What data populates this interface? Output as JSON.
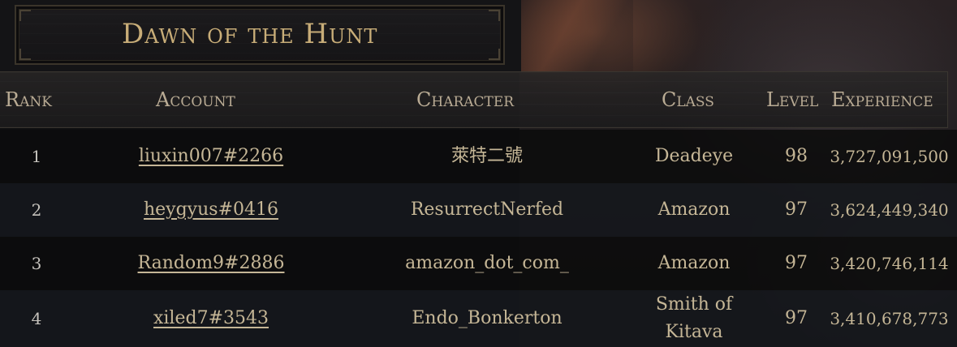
{
  "title": "Dawn of the Hunt",
  "columns": {
    "rank": "Rank",
    "account": "Account",
    "character": "Character",
    "class": "Class",
    "level": "Level",
    "experience": "Experience"
  },
  "rows": [
    {
      "rank": "1",
      "account": "liuxin007#2266",
      "character": "萊特二號",
      "class": "Deadeye",
      "level": "98",
      "experience": "3,727,091,500"
    },
    {
      "rank": "2",
      "account": "heygyus#0416",
      "character": "ResurrectNerfed",
      "class": "Amazon",
      "level": "97",
      "experience": "3,624,449,340"
    },
    {
      "rank": "3",
      "account": "Random9#2886",
      "character": "amazon_dot_com_",
      "class": "Amazon",
      "level": "97",
      "experience": "3,420,746,114"
    },
    {
      "rank": "4",
      "account": "xiled7#3543",
      "character": "Endo_Bonkerton",
      "class": "Smith of Kitava",
      "level": "97",
      "experience": "3,410,678,773"
    }
  ],
  "colors": {
    "title_gold": "#c8ad78",
    "text": "#c5b696",
    "header_text": "#b9ab94"
  }
}
